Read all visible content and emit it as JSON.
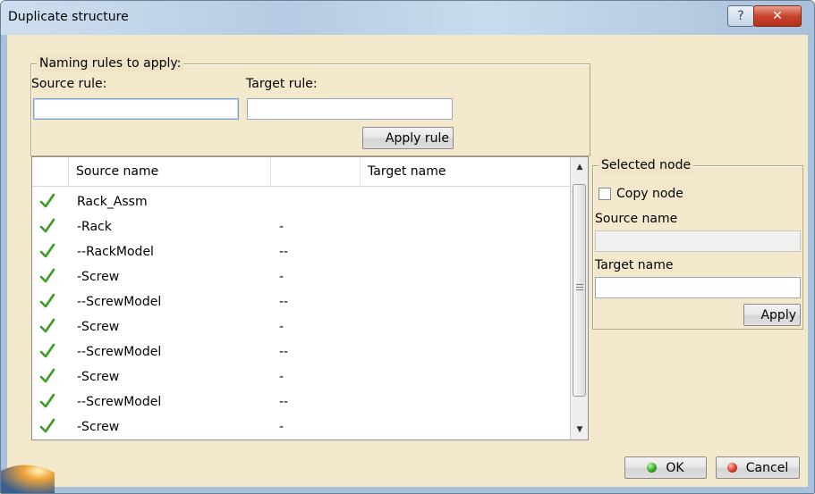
{
  "window": {
    "title": "Duplicate structure",
    "help_glyph": "?",
    "close_glyph": "✕"
  },
  "naming": {
    "legend": "Naming rules to apply:",
    "source_rule_label": "Source rule:",
    "source_rule_value": "",
    "target_rule_label": "Target rule:",
    "target_rule_value": "",
    "apply_rule_label": "Apply rule"
  },
  "tree": {
    "columns": [
      "Source name",
      "",
      "Target name"
    ],
    "check_color": "#3a9d22",
    "rows": [
      {
        "source": "Rack_Assm",
        "level": ""
      },
      {
        "source": "-Rack",
        "level": "-"
      },
      {
        "source": "--RackModel",
        "level": "--"
      },
      {
        "source": "-Screw",
        "level": "-"
      },
      {
        "source": "--ScrewModel",
        "level": "--"
      },
      {
        "source": "-Screw",
        "level": "-"
      },
      {
        "source": "--ScrewModel",
        "level": "--"
      },
      {
        "source": "-Screw",
        "level": "-"
      },
      {
        "source": "--ScrewModel",
        "level": "--"
      },
      {
        "source": "-Screw",
        "level": "-"
      }
    ]
  },
  "selected_node": {
    "legend": "Selected node",
    "copy_node_label": "Copy node",
    "copy_node_checked": false,
    "source_name_label": "Source name",
    "source_name_value": "",
    "target_name_label": "Target name",
    "target_name_value": "",
    "apply_label": "Apply"
  },
  "footer": {
    "ok_label": "OK",
    "cancel_label": "Cancel",
    "ok_color": "#27a21a",
    "cancel_color": "#d8321f"
  }
}
